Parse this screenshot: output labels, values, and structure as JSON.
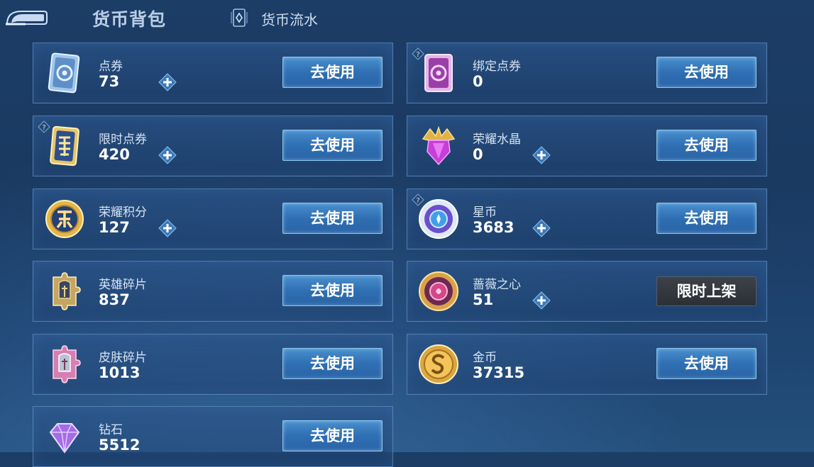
{
  "header": {
    "title": "货币背包",
    "flow_label": "货币流水"
  },
  "currencies": [
    {
      "name": "点券",
      "amount": "73",
      "button": "去使用"
    },
    {
      "name": "绑定点券",
      "amount": "0",
      "button": "去使用"
    },
    {
      "name": "限时点券",
      "amount": "420",
      "button": "去使用"
    },
    {
      "name": "荣耀水晶",
      "amount": "0",
      "button": "去使用"
    },
    {
      "name": "荣耀积分",
      "amount": "127",
      "button": "去使用"
    },
    {
      "name": "星币",
      "amount": "3683",
      "button": "去使用"
    },
    {
      "name": "英雄碎片",
      "amount": "837",
      "button": "去使用"
    },
    {
      "name": "蔷薇之心",
      "amount": "51",
      "button": "限时上架"
    },
    {
      "name": "皮肤碎片",
      "amount": "1013",
      "button": "去使用"
    },
    {
      "name": "金币",
      "amount": "37315",
      "button": "去使用"
    },
    {
      "name": "钻石",
      "amount": "5512",
      "button": "去使用"
    }
  ],
  "icons": {
    "voucher": "voucher-card-icon",
    "bound_voucher": "bound-voucher-card-icon",
    "limited_voucher": "limited-voucher-icon",
    "crystal": "glory-crystal-icon",
    "points": "glory-points-icon",
    "star_coin": "star-coin-icon",
    "hero_fragment": "hero-fragment-icon",
    "rose_heart": "rose-heart-icon",
    "skin_fragment": "skin-fragment-icon",
    "gold": "gold-coin-icon",
    "diamond": "diamond-icon"
  },
  "colors": {
    "accent": "#2f6fb3",
    "button_border": "#8cc8f2",
    "disabled_button": "#2c3035"
  }
}
